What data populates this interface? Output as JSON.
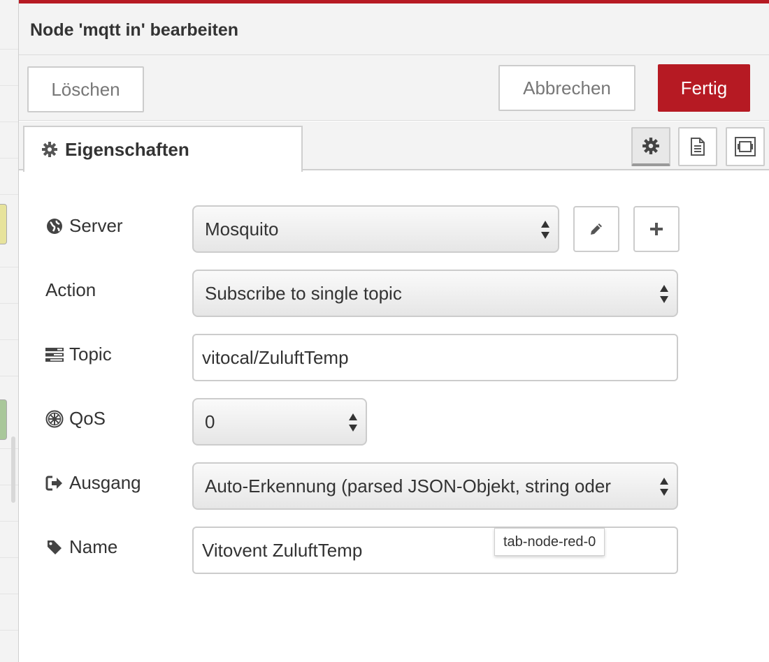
{
  "tray": {
    "title": "Node 'mqtt in' bearbeiten",
    "accent_color": "#b61a23"
  },
  "toolbar": {
    "delete_label": "Löschen",
    "cancel_label": "Abbrechen",
    "done_label": "Fertig"
  },
  "tabs": {
    "properties": {
      "label": "Eigenschaften",
      "icon": "gear-icon"
    },
    "icon_buttons": [
      {
        "name": "settings",
        "icon": "gear-icon",
        "active": true
      },
      {
        "name": "description",
        "icon": "document-icon",
        "active": false
      },
      {
        "name": "appearance",
        "icon": "node-appearance-icon",
        "active": false
      }
    ]
  },
  "form": {
    "server": {
      "label": "Server",
      "icon": "globe-icon",
      "value": "Mosquito"
    },
    "action": {
      "label": "Action",
      "value": "Subscribe to single topic"
    },
    "topic": {
      "label": "Topic",
      "icon": "tasks-icon",
      "value": "vitocal/ZuluftTemp"
    },
    "qos": {
      "label": "QoS",
      "icon": "empire-icon",
      "value": "0"
    },
    "output": {
      "label": "Ausgang",
      "icon": "sign-out-icon",
      "value": "Auto-Erkennung (parsed JSON-Objekt, string oder"
    },
    "name": {
      "label": "Name",
      "icon": "tag-icon",
      "value": "Vitovent ZuluftTemp"
    }
  },
  "tooltip": {
    "text": "tab-node-red-0"
  }
}
